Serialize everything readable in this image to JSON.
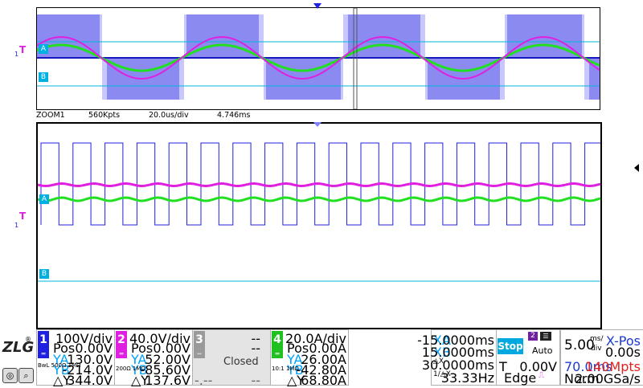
{
  "overview": {
    "marker_a": "A",
    "marker_b": "B",
    "trigger_marker": "T"
  },
  "zoom_info": {
    "name": "ZOOM1",
    "points": "560Kpts",
    "timebase": "20.0us/div",
    "position": "4.746ms"
  },
  "zoom": {
    "marker_a": "A",
    "marker_b": "B",
    "trigger_marker": "T"
  },
  "channels": [
    {
      "num": "1",
      "scale": "100V/div",
      "pos_label": "Pos",
      "pos": "0.00V",
      "ya_label": "YA",
      "ya": "130.0V",
      "yb_label": "YB",
      "yb": "-214.0V",
      "dy_label": "△Y",
      "dy": "344.0V",
      "coupling": "BwL 500Ω 1MΩ",
      "color": "#2020e0"
    },
    {
      "num": "2",
      "scale": "40.0V/div",
      "pos_label": "Pos",
      "pos": "0.00V",
      "ya_label": "YA",
      "ya": "52.00V",
      "yb_label": "YB",
      "yb": "-85.60V",
      "dy_label": "△Y",
      "dy": "137.6V",
      "coupling": "200Ω 1MΩ",
      "color": "#e020e0"
    },
    {
      "num": "3",
      "scale": "--",
      "pos": "--",
      "status": "Closed",
      "dash1": "-.--",
      "dash2": "--",
      "color": "#9a9a9a"
    },
    {
      "num": "4",
      "scale": "20.0A/div",
      "pos_label": "Pos",
      "pos": "0.00A",
      "ya_label": "YA",
      "ya": "26.00A",
      "yb_label": "YB",
      "yb": "-42.80A",
      "dy_label": "△Y",
      "dy": "68.80A",
      "coupling": "10:1 1MΩ",
      "color": "#20c020"
    }
  ],
  "cursors": {
    "xa_label": "XA",
    "xa": "-15.0000ms",
    "xb_label": "XB",
    "xb": "15.0000ms",
    "dx_label": "△X",
    "dx": "30.0000ms",
    "inv_label": "1/△X",
    "inv": "33.33Hz"
  },
  "trigger": {
    "state": "Stop",
    "source": "2",
    "mode": "Auto",
    "label": "T",
    "level": "0.00V",
    "type": "Edge"
  },
  "timebase": {
    "value": "5.00",
    "unit_top": "ms/",
    "unit_bot": "div",
    "xpos_label": "X-Pos",
    "xpos": "0.00s",
    "delay": "70.0ms",
    "mem": "140Mpts",
    "acq": "Norm",
    "rate": "2.00GSa/s"
  },
  "logo": "ZLG"
}
